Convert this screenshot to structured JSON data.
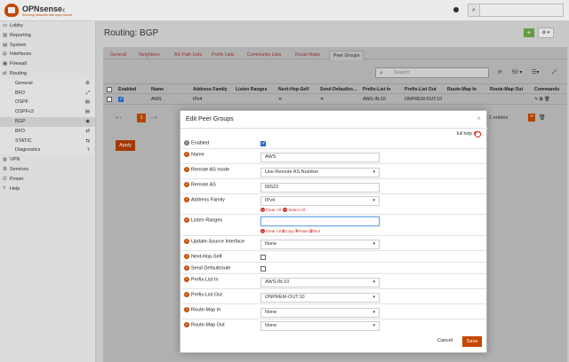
{
  "brand": {
    "name": "OPNsense",
    "tagline": "Securing networks with open source",
    "collapse": "‹"
  },
  "sidebar": {
    "items": [
      {
        "label": "Lobby",
        "icon": "▭"
      },
      {
        "label": "Reporting",
        "icon": "▥"
      },
      {
        "label": "System",
        "icon": "▤"
      },
      {
        "label": "Interfaces",
        "icon": "⊟"
      },
      {
        "label": "Firewall",
        "icon": "▦"
      },
      {
        "label": "Routing",
        "icon": "⇄"
      },
      {
        "label": "General",
        "ricon": "⚙"
      },
      {
        "label": "BFD",
        "ricon": "⤢"
      },
      {
        "label": "OSPF",
        "ricon": "▤"
      },
      {
        "label": "OSPFv3",
        "ricon": "▤"
      },
      {
        "label": "BGP",
        "ricon": "◉"
      },
      {
        "label": "BFD",
        "ricon": "⇄"
      },
      {
        "label": "STATIC",
        "ricon": "⇆"
      },
      {
        "label": "Diagnostics",
        "ricon": "⚕"
      },
      {
        "label": "VPN",
        "icon": "◍"
      },
      {
        "label": "Services",
        "icon": "⚙"
      },
      {
        "label": "Power",
        "icon": "⏻"
      },
      {
        "label": "Help",
        "icon": "?"
      }
    ]
  },
  "page": {
    "title": "Routing: BGP",
    "add": "+",
    "dropdown": "⚙ ▾"
  },
  "tabs": [
    "General",
    "Neighbors",
    "AS Path Lists",
    "Prefix Lists",
    "Community Lists",
    "Route Maps",
    "Peer Groups"
  ],
  "grid": {
    "search_placeholder": "Search",
    "refresh": "⟳",
    "pagesize": "50 ▾",
    "cols": "☰▾",
    "fullscreen": "⤢",
    "headers": [
      "Enabled",
      "Name",
      "Address Family",
      "Listen Ranges",
      "Next-Hop-Self",
      "Send Defaultro…",
      "Prefix-List In",
      "Prefix-List Out",
      "Route-Map In",
      "Route-Map Out",
      "Commands"
    ],
    "row": {
      "name": "AWS",
      "family": "IPv4",
      "nexthop": "✕",
      "senddefault": "✕",
      "prefix_in": "AWS-IN:10",
      "prefix_out": "ONPREM-OUT:10",
      "commands": "✎ ⧉ 🗑"
    },
    "page": "1",
    "prev": "«  ‹",
    "next": "›  »",
    "entries": "of 1 entries",
    "add": "+",
    "del": "🗑"
  },
  "apply": "Apply",
  "modal": {
    "title": "Edit Peer Groups",
    "close": "×",
    "full_help": "full help",
    "fields": {
      "enabled": "Enabled",
      "name": "Name",
      "name_value": "AWS",
      "remote_as_mode": "Remote AS mode",
      "remote_as_mode_value": "Use Remote AS Number",
      "remote_as": "Remote AS",
      "remote_as_value": "65522",
      "address_family": "Address Family",
      "address_family_value": "IPv4",
      "clear_all": "Clear All",
      "select_all": "Select All",
      "listen_ranges": "Listen Ranges",
      "lr_clear": "Clear All",
      "lr_copy": "Copy",
      "lr_paste": "Paste",
      "lr_text": "Text",
      "update_source": "Update-Source Interface",
      "update_source_value": "None",
      "next_hop_self": "Next-Hop-Self",
      "send_default": "Send Defaultroute",
      "prefix_in": "Prefix-List In",
      "prefix_in_value": "AWS-IN:10",
      "prefix_out": "Prefix-List Out",
      "prefix_out_value": "ONPREM-OUT:10",
      "route_in": "Route-Map In",
      "route_in_value": "None",
      "route_out": "Route-Map Out",
      "route_out_value": "None"
    },
    "cancel": "Cancel",
    "save": "Save"
  }
}
